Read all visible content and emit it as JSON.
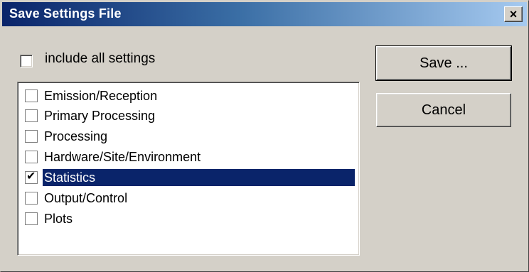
{
  "window": {
    "title": "Save Settings File",
    "close_glyph": "×"
  },
  "include_all": {
    "label": "include all settings",
    "checked": false
  },
  "list": {
    "items": [
      {
        "label": "Emission/Reception",
        "checked": false,
        "selected": false
      },
      {
        "label": "Primary Processing",
        "checked": false,
        "selected": false
      },
      {
        "label": "Processing",
        "checked": false,
        "selected": false
      },
      {
        "label": "Hardware/Site/Environment",
        "checked": false,
        "selected": false
      },
      {
        "label": "Statistics",
        "checked": true,
        "selected": true
      },
      {
        "label": "Output/Control",
        "checked": false,
        "selected": false
      },
      {
        "label": "Plots",
        "checked": false,
        "selected": false
      }
    ]
  },
  "buttons": {
    "save": "Save ...",
    "cancel": "Cancel"
  },
  "icons": {
    "close": "close-icon",
    "check": "checkmark-icon"
  },
  "colors": {
    "title_start": "#0a246a",
    "title_end": "#a6caf0",
    "selection": "#0a246a",
    "face": "#d4d0c8"
  }
}
